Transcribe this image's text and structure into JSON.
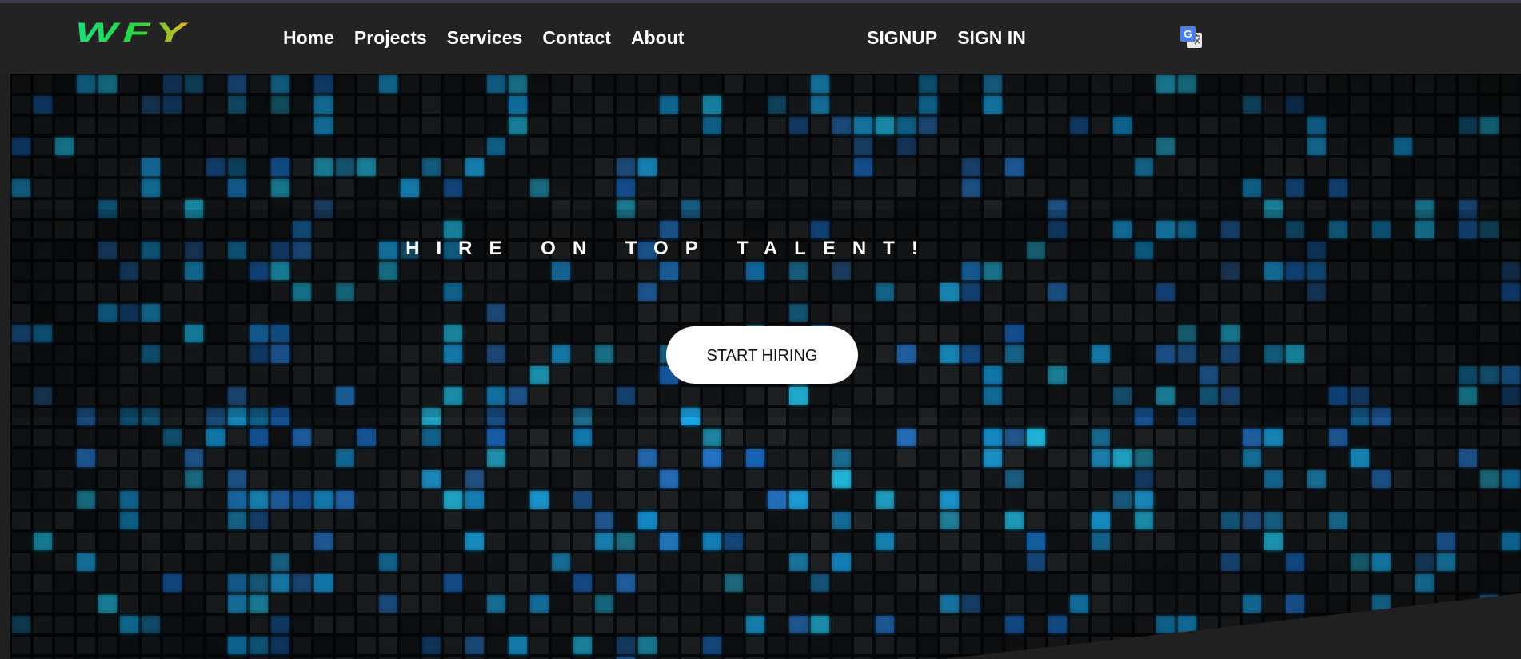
{
  "header": {
    "logo_text": "WFY",
    "nav": [
      "Home",
      "Projects",
      "Services",
      "Contact",
      "About"
    ],
    "auth": [
      "SIGNUP",
      "SIGN IN"
    ],
    "translate_icon": "google-translate-icon"
  },
  "hero": {
    "title": "HIRE ON TOP TALENT!",
    "cta_label": "START HIRING",
    "background": "digital-matrix-grid"
  },
  "colors": {
    "navbar_bg": "#232323",
    "hero_accent": "#1fb8ff",
    "cta_bg": "#ffffff",
    "logo_gradient": [
      "#16e07a",
      "#2bd640",
      "#f0b21a"
    ]
  }
}
